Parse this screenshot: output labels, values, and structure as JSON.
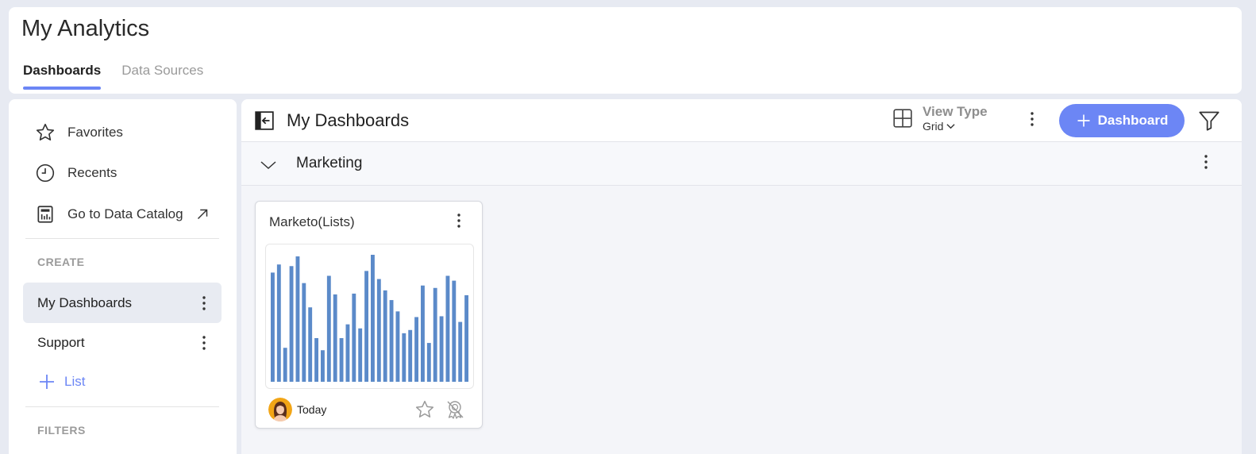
{
  "app": {
    "title": "My Analytics"
  },
  "tabs": [
    {
      "label": "Dashboards",
      "active": true
    },
    {
      "label": "Data Sources",
      "active": false
    }
  ],
  "sidebar": {
    "favorites_label": "Favorites",
    "recents_label": "Recents",
    "catalog_label": "Go to Data Catalog",
    "create_section": "CREATE",
    "lists": [
      {
        "label": "My Dashboards",
        "selected": true
      },
      {
        "label": "Support",
        "selected": false
      }
    ],
    "add_list_label": "List",
    "filters_section": "FILTERS"
  },
  "main": {
    "title": "My Dashboards",
    "view_type_label": "View Type",
    "view_type_value": "Grid",
    "add_dashboard_label": "Dashboard",
    "group": {
      "name": "Marketing"
    },
    "card": {
      "title": "Marketo(Lists)",
      "date": "Today",
      "thumbnail_values": [
        135,
        145,
        42,
        143,
        155,
        122,
        92,
        54,
        39,
        131,
        108,
        54,
        71,
        109,
        66,
        137,
        157,
        127,
        113,
        101,
        87,
        60,
        64,
        80,
        119,
        48,
        116,
        81,
        131,
        125,
        74,
        107
      ]
    }
  },
  "colors": {
    "accent": "#6c86f5",
    "bar": "#5b8ac9"
  }
}
